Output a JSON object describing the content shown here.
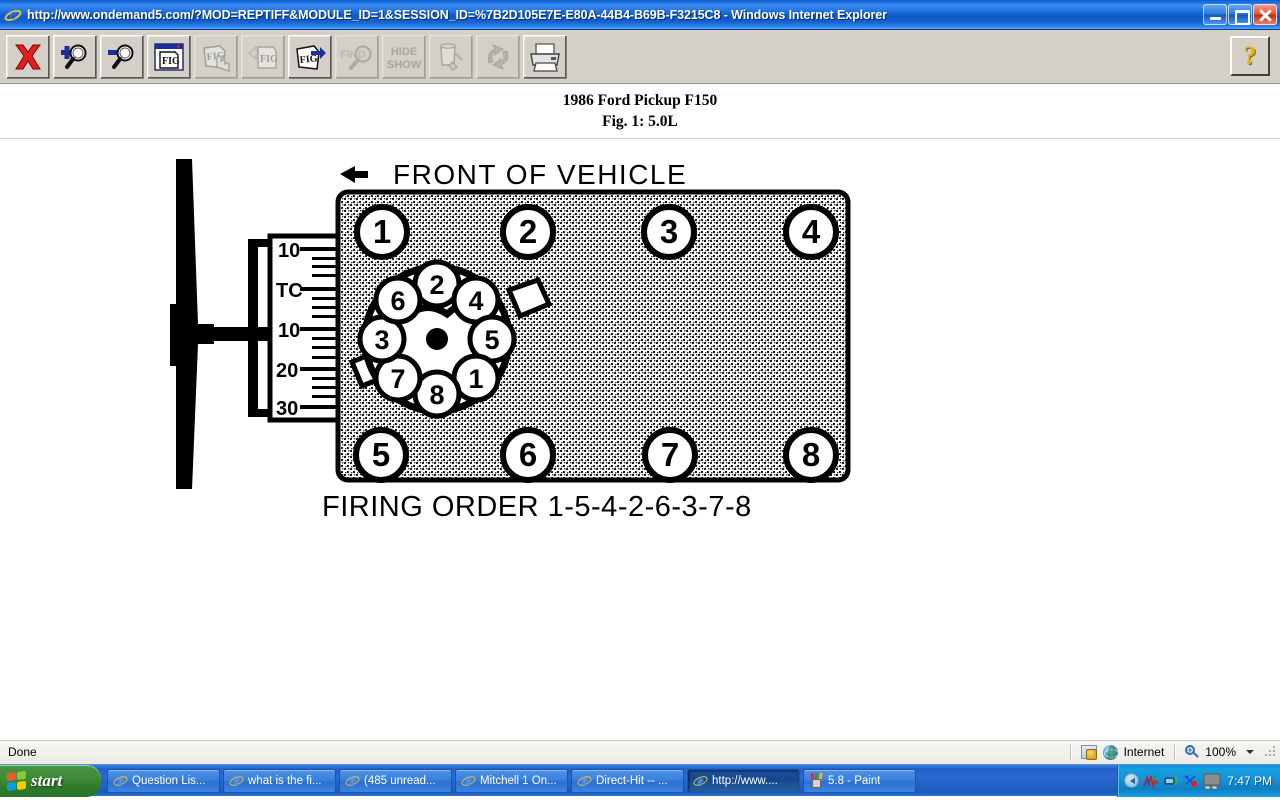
{
  "window": {
    "title": "http://www.ondemand5.com/?MOD=REPTIFF&MODULE_ID=1&SESSION_ID=%7B2D105E7E-E80A-44B4-B69B-F3215C8 - Windows Internet Explorer",
    "minimize_label": "Minimize",
    "maximize_label": "Restore Down",
    "close_label": "Close"
  },
  "toolbar": {
    "buttons": [
      {
        "name": "close-figure-button",
        "icon": "red-x-icon",
        "label": "X",
        "enabled": true
      },
      {
        "name": "zoom-in-button",
        "icon": "magnifier-plus-icon",
        "label": "Zoom In",
        "enabled": true
      },
      {
        "name": "zoom-out-button",
        "icon": "magnifier-minus-icon",
        "label": "Zoom Out",
        "enabled": true
      },
      {
        "name": "figure-window-button",
        "icon": "fig-window-icon",
        "label": "FIG",
        "enabled": true
      },
      {
        "name": "figure-drag-button",
        "icon": "fig-hand-icon",
        "label": "FIG",
        "enabled": false
      },
      {
        "name": "figure-previous-button",
        "icon": "fig-back-arrow-icon",
        "label": "FIG",
        "enabled": false
      },
      {
        "name": "figure-next-button",
        "icon": "fig-forward-arrow-icon",
        "label": "FIG",
        "enabled": true
      },
      {
        "name": "find-button",
        "icon": "find-magnifier-icon",
        "label": "FIND",
        "enabled": false
      },
      {
        "name": "hide-show-button",
        "icon": "hide-show-text-icon",
        "label1": "HIDE",
        "label2": "SHOW",
        "enabled": false
      },
      {
        "name": "highlight-button",
        "icon": "paint-bucket-icon",
        "label": "Highlight",
        "enabled": false
      },
      {
        "name": "rotate-button",
        "icon": "rotate-arrows-icon",
        "label": "Rotate",
        "enabled": false
      },
      {
        "name": "print-button",
        "icon": "printer-icon",
        "label": "Print",
        "enabled": true
      }
    ],
    "help_label": "?"
  },
  "document": {
    "heading": "1986 Ford Pickup F150",
    "subheading": "Fig. 1: 5.0L"
  },
  "figure": {
    "front_label": "FRONT OF VEHICLE",
    "firing_order_label": "FIRING ORDER 1-5-4-2-6-3-7-8",
    "cylinders_top": [
      "1",
      "2",
      "3",
      "4"
    ],
    "cylinders_bottom": [
      "5",
      "6",
      "7",
      "8"
    ],
    "distributor_terminals": [
      "2",
      "4",
      "5",
      "1",
      "8",
      "7",
      "3",
      "6"
    ],
    "timing_scale_labels": [
      "10",
      "TC",
      "10",
      "20",
      "30"
    ],
    "colors": {
      "ink": "#000000",
      "block_fill": "#e8e8e8",
      "page": "#ffffff"
    }
  },
  "statusbar": {
    "status_text": "Done",
    "zone_label": "Internet",
    "zoom_level": "100%"
  },
  "taskbar": {
    "start_label": "start",
    "items": [
      {
        "label": "Question Lis...",
        "icon": "ie-icon",
        "active": false
      },
      {
        "label": "what is the fi...",
        "icon": "ie-icon",
        "active": false
      },
      {
        "label": "(485 unread...",
        "icon": "ie-icon",
        "active": false
      },
      {
        "label": "Mitchell 1 On...",
        "icon": "ie-icon",
        "active": false
      },
      {
        "label": "Direct-Hit -- ...",
        "icon": "ie-icon",
        "active": false
      },
      {
        "label": "http://www....",
        "icon": "ie-icon",
        "active": true
      },
      {
        "label": "5.8 - Paint",
        "icon": "paint-icon",
        "active": false
      }
    ],
    "clock": "7:47 PM"
  }
}
